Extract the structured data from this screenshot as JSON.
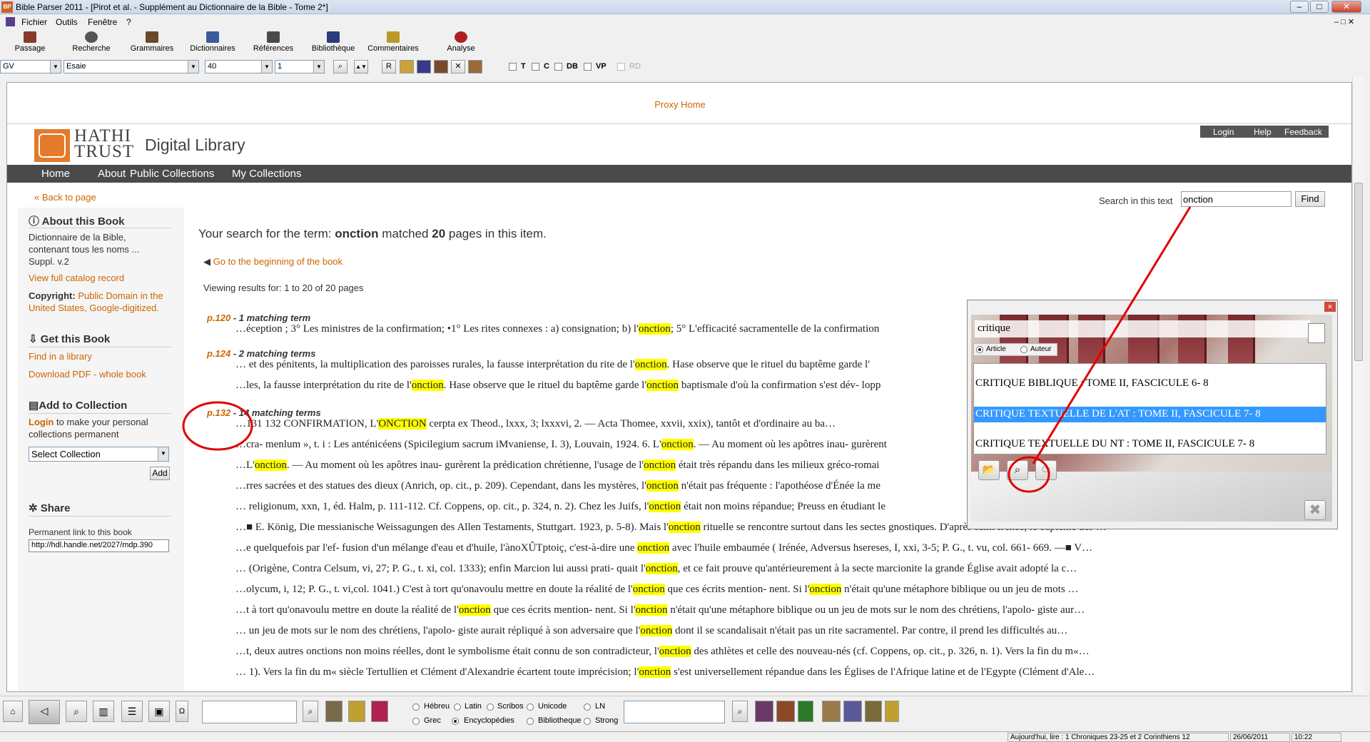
{
  "window": {
    "title": "Bible Parser 2011 - [Pirot et al. - Supplément au Dictionnaire de la Bible - Tome 2*]",
    "app_icon": "BP"
  },
  "menu": [
    "Fichier",
    "Outils",
    "Fenêtre",
    "?"
  ],
  "toolbar": [
    "Passage",
    "Recherche",
    "Grammaires",
    "Dictionnaires",
    "Références",
    "Bibliothèque",
    "Commentaires",
    "Analyse"
  ],
  "nav": {
    "version": "GV",
    "book": "Esaie",
    "chapter": "40",
    "verse": "1",
    "r_label": "R",
    "checks": [
      "T",
      "C",
      "DB",
      "VP",
      "RD"
    ]
  },
  "page": {
    "proxy": "Proxy Home",
    "logo_line1": "HATHI",
    "logo_line2": "TRUST",
    "digital_library": "Digital Library",
    "toplinks": [
      "Login",
      "Help",
      "Feedback"
    ],
    "mainnav": [
      "Home",
      "About",
      "Public Collections",
      "My Collections"
    ],
    "back": "« Back to page",
    "search_label": "Search in this text",
    "search_value": "onction",
    "find": "Find",
    "sidebar": {
      "about_h": "About this Book",
      "about_title": "Dictionnaire de la Bible, contenant tous les noms ...",
      "about_vol": "Suppl. v.2",
      "catalog": "View full catalog record",
      "copyright_label": "Copyright:",
      "copyright_val": "Public Domain in the United States, Google-digitized.",
      "get_h": "Get this Book",
      "find_lib": "Find in a library",
      "download": "Download PDF - whole book",
      "add_h": "Add to Collection",
      "login": "Login",
      "login_rest": "to make your personal collections permanent",
      "select": "Select Collection",
      "add_btn": "Add",
      "share_h": "Share",
      "perm": "Permanent link to this book",
      "perm_val": "http://hdl.handle.net/2027/mdp.390"
    },
    "summary_pre": "Your search for the term: ",
    "summary_term": "onction",
    "summary_mid": " matched ",
    "summary_count": "20",
    "summary_post": " pages in this item.",
    "goto_begin": "Go to the beginning of the book",
    "viewing": "Viewing results for: 1 to 20 of 20 pages",
    "results": [
      {
        "page": "p.120",
        "terms": " - 1 matching term",
        "lines": [
          [
            "…éception ; 3° Les ministres de la confirmation; •1° Les rites connexes : a) consignation; b) l'",
            "onction",
            "; 5° L'efficacité sacramentelle de la confirmation",
            "",
            ""
          ]
        ]
      },
      {
        "page": "p.124",
        "terms": " - 2 matching terms",
        "lines": [
          [
            "… et des pénitents, la multiplication des paroisses rurales, la fausse interprétation du rite de l'",
            "onction",
            ". Hase observe que le rituel du baptême garde l'",
            "",
            ""
          ],
          [
            "…les, la fausse interprétation du rite de l'",
            "onction",
            ". Hase observe que le rituel du baptême garde l'",
            "onction",
            " baptismale d'où la confirmation s'est dév- lopp"
          ]
        ]
      },
      {
        "page": "p.132",
        "terms": " - 14 matching terms",
        "lines": [
          [
            "…131 132 CONFIRMATION, L'",
            "ONCTION",
            " cerpta ex Theod., lxxx, 3; lxxxvi, 2. — Acta Thomee, xxvii, xxix), tantôt et d'ordinaire au ba…",
            "",
            ""
          ],
          [
            "…cra- menlum », t. i : Les anténicéens (Spicilegium sacrum iMvaniense, I. 3), Louvain, 1924. 6. L'",
            "onction",
            ". — Au moment où les apôtres inau- gurèrent",
            "",
            ""
          ],
          [
            "…L'",
            "onction",
            ". — Au moment où les apôtres inau- gurèrent la prédication chrétienne, l'usage de l'",
            "onction",
            " était très répandu dans les milieux gréco-romai"
          ],
          [
            "…rres sacrées et des statues des dieux (Anrich, op. cit., p. 209). Cependant, dans les mystères, l'",
            "onction",
            " n'était pas fréquente : l'apothéose d'Énée la me",
            "",
            ""
          ],
          [
            "… religionum, xxn, 1, éd. Halm, p. 111-112. Cf. Coppens, op. cit., p. 324, n. 2). Chez les Juifs, l'",
            "onction",
            " était non moins répandue; Preuss en étudiant le",
            "",
            ""
          ],
          [
            "…■ E. König, Die messianische Weissagungen des Allen Testaments, Stuttgart. 1923, p. 5-8). Mais l'",
            "onction",
            " rituelle se rencontre surtout dans les sectes gnostiques. D'après saint Irénée, le baptême des …",
            "",
            ""
          ],
          [
            "…e quelquefois par l'ef- fusion d'un mélange d'eau et d'huile, l'ànoXÛTptoiç, c'est-à-dire une ",
            "onction",
            " avec l'huile embaumée ( Irénée, Adversus hsereses, I, xxi, 3-5; P. G., t. vu, col. 661- 669. —■ V…",
            "",
            ""
          ],
          [
            "… (Origène, Contra Celsum, vi, 27; P. G., t. xi, col. 1333); enfin Marcion lui aussi prati- quait l'",
            "onction",
            ", et ce fait prouve qu'antérieurement à la secte marcionite la grande Église avait adopté la c…",
            "",
            ""
          ],
          [
            "…olycum, i, 12; P. G., t. vi,col. 1041.) C'est à tort qu'onavoulu mettre en doute la réalité de l'",
            "onction",
            " que ces écrits mention- nent. Si l'",
            "onction",
            " n'était qu'une métaphore biblique ou un jeu de mots …"
          ],
          [
            "…t à tort qu'onavoulu mettre en doute la réalité de l'",
            "onction",
            " que ces écrits mention- nent. Si l'",
            "onction",
            " n'était qu'une métaphore biblique ou un jeu de mots sur le nom des chrétiens, l'apolo- giste aur…"
          ],
          [
            "… un jeu de mots sur le nom des chrétiens, l'apolo- giste aurait répliqué à son adversaire que l'",
            "onction",
            " dont il se scandalisait n'était pas un rite sacramentel. Par contre, il prend les difficultés au…",
            "",
            ""
          ],
          [
            "…t, deux autres onctions non moins réelles, dont le symbolisme était connu de son contradicteur, l'",
            "onction",
            " des athlètes et celle des nouveau-nés (cf. Coppens, op. cit., p. 326, n. 1). Vers la fin du m«…",
            "",
            ""
          ],
          [
            "… 1). Vers la fin du m« siècle Tertullien et Clément d'Alexandrie écartent toute imprécision; l'",
            "onction",
            " s'est universellement répandue dans les Églises de l'Afrique latine et de l'Egypte (Clément d'Ale…",
            "",
            ""
          ]
        ]
      }
    ]
  },
  "popup": {
    "search": "critique",
    "radio_article": "Article",
    "radio_auteur": "Auteur",
    "items": [
      "CRITIQUE BIBLIQUE : TOME II, FASCICULE 6- 8",
      "CRITIQUE TEXTUELLE DE L'AT : TOME II, FASCICULE 7- 8",
      "CRITIQUE TEXTUELLE DU NT : TOME II, FASCICULE 7- 8"
    ],
    "selected_index": 1
  },
  "bottom": {
    "radios_row1": [
      "Hébreu",
      "Latin",
      "Scribos",
      "Unicode",
      "LN"
    ],
    "radios_row2": [
      "Grec",
      "Encyclopédies",
      "Bibliotheque",
      "Strong"
    ],
    "selected": "Encyclopédies"
  },
  "status": {
    "reading": "Aujourd'hui, lire : 1 Chroniques 23-25 et 2 Corinthiens 12",
    "date": "26/06/2011",
    "time": "10:22"
  },
  "colors": {
    "accent": "#cc6600",
    "highlight": "#ffff00",
    "annotation": "#e00000",
    "selection": "#3399ff"
  }
}
